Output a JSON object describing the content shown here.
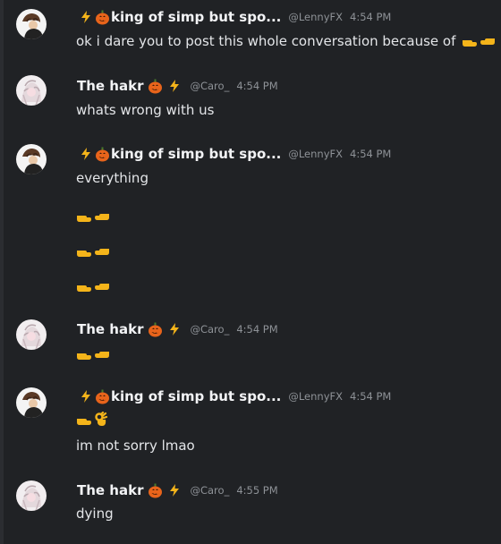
{
  "users": {
    "lenny": {
      "display_name": "king of simp but spo...",
      "handle": "@LennyFX",
      "avatar_icon": "dark-haired-avatar-icon"
    },
    "caro": {
      "display_name": "The hakr",
      "handle": "@Caro_",
      "avatar_icon": "pale-sketch-avatar-icon"
    }
  },
  "messages": [
    {
      "time": "4:54 PM",
      "lines": [
        "ok i dare you to post this whole conversation because of"
      ]
    },
    {
      "time": "4:54 PM",
      "lines": [
        "whats wrong with us"
      ]
    },
    {
      "time": "4:54 PM",
      "lines": [
        "everything"
      ]
    },
    {
      "time": "4:54 PM",
      "lines": []
    },
    {
      "time": "4:54 PM",
      "lines": [
        "im not sorry lmao"
      ]
    },
    {
      "time": "4:55 PM",
      "lines": [
        "dying"
      ]
    }
  ],
  "icons": [
    "lightning-emoji-icon",
    "pumpkin-emoji-icon",
    "pointing-hands-emoji-icon",
    "ok-hand-emoji-icon"
  ],
  "colors": {
    "background": "#202225",
    "username": "#f2f3f5",
    "text": "#e3e5e8",
    "muted": "#8e9297",
    "emoji_yellow": "#f4b41a",
    "pumpkin": "#e8641b"
  }
}
